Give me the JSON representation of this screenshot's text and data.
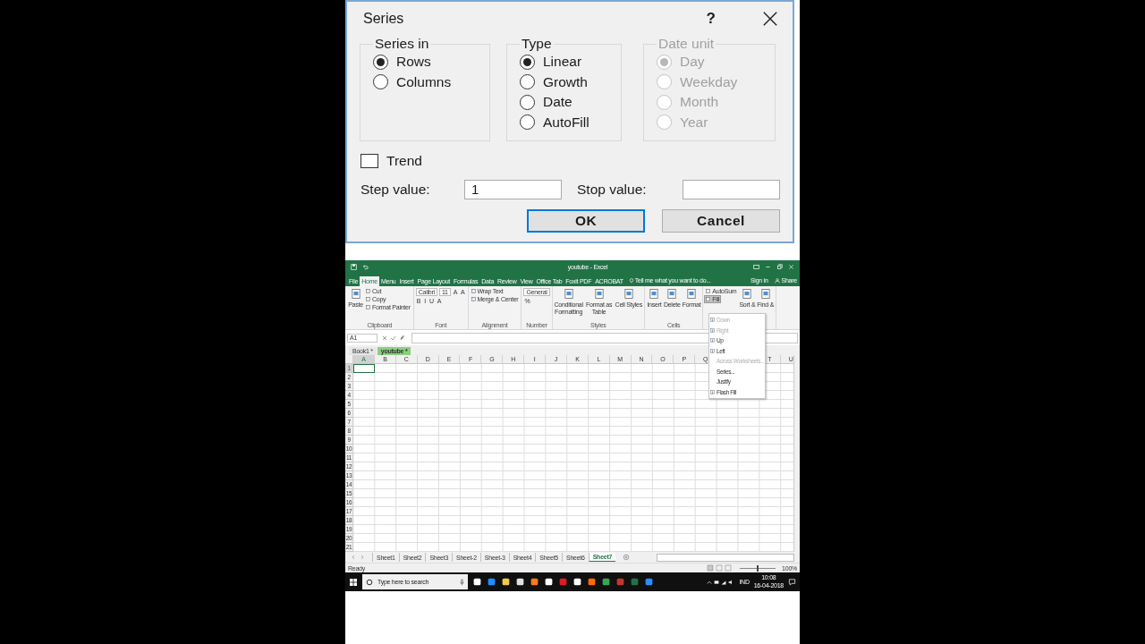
{
  "dialog": {
    "title": "Series",
    "help": "?",
    "groups": [
      {
        "title": "Series in",
        "disabled": false,
        "options": [
          {
            "label": "Rows",
            "selected": true,
            "disabled": false
          },
          {
            "label": "Columns",
            "selected": false,
            "disabled": false
          }
        ]
      },
      {
        "title": "Type",
        "disabled": false,
        "options": [
          {
            "label": "Linear",
            "selected": true,
            "disabled": false
          },
          {
            "label": "Growth",
            "selected": false,
            "disabled": false
          },
          {
            "label": "Date",
            "selected": false,
            "disabled": false
          },
          {
            "label": "AutoFill",
            "selected": false,
            "disabled": false
          }
        ]
      },
      {
        "title": "Date unit",
        "disabled": true,
        "options": [
          {
            "label": "Day",
            "selected": true,
            "disabled": true
          },
          {
            "label": "Weekday",
            "selected": false,
            "disabled": true
          },
          {
            "label": "Month",
            "selected": false,
            "disabled": true
          },
          {
            "label": "Year",
            "selected": false,
            "disabled": true
          }
        ]
      }
    ],
    "trend": {
      "label": "Trend",
      "checked": false
    },
    "fields": [
      {
        "label": "Step value:",
        "value": "1"
      },
      {
        "label": "Stop value:"
      }
    ],
    "buttons": [
      {
        "label": "OK",
        "default": true
      },
      {
        "label": "Cancel",
        "default": false
      }
    ]
  },
  "excel": {
    "title": "youtube - Excel",
    "tabs": [
      {
        "label": "File",
        "selected": false
      },
      {
        "label": "Home",
        "selected": true
      },
      {
        "label": "Menu",
        "selected": false
      },
      {
        "label": "Insert",
        "selected": false
      },
      {
        "label": "Page Layout",
        "selected": false
      },
      {
        "label": "Formulas",
        "selected": false
      },
      {
        "label": "Data",
        "selected": false
      },
      {
        "label": "Review",
        "selected": false
      },
      {
        "label": "View",
        "selected": false
      },
      {
        "label": "Office Tab",
        "selected": false
      },
      {
        "label": "Foxit PDF",
        "selected": false
      },
      {
        "label": "ACROBAT",
        "selected": false
      }
    ],
    "tell_me": "Tell me what you want to do...",
    "sign_in": "Sign in",
    "share": "Share",
    "ribbon": [
      {
        "label": "Clipboard",
        "cols": [
          [
            [
              {
                "kind": "large",
                "label": "Paste"
              }
            ]
          ],
          [
            [
              {
                "kind": "small",
                "label": "Cut",
                "pressed": false
              }
            ],
            [
              {
                "kind": "small",
                "label": "Copy",
                "pressed": false
              }
            ],
            [
              {
                "kind": "small",
                "label": "Format Painter",
                "pressed": false
              }
            ]
          ]
        ]
      },
      {
        "label": "Font",
        "cols": [
          [
            [
              {
                "kind": "field",
                "label": "Calibri"
              },
              {
                "kind": "field",
                "label": "11"
              },
              {
                "kind": "glyph",
                "label": "A"
              },
              {
                "kind": "glyph",
                "label": "A"
              }
            ],
            [
              {
                "kind": "glyph",
                "label": "B"
              },
              {
                "kind": "glyph",
                "label": "I"
              },
              {
                "kind": "glyph",
                "label": "U"
              },
              {
                "kind": "glyph",
                "label": "A"
              }
            ]
          ]
        ]
      },
      {
        "label": "Alignment",
        "cols": [
          [
            [
              {
                "kind": "small",
                "label": "Wrap Text",
                "pressed": false
              }
            ],
            [
              {
                "kind": "small",
                "label": "Merge & Center",
                "pressed": false
              }
            ]
          ]
        ]
      },
      {
        "label": "Number",
        "cols": [
          [
            [
              {
                "kind": "field",
                "label": "General"
              }
            ],
            [
              {
                "kind": "glyph",
                "label": "%"
              }
            ]
          ]
        ]
      },
      {
        "label": "Styles",
        "cols": [
          [
            [
              {
                "kind": "large",
                "label": "Conditional Formatting"
              }
            ]
          ],
          [
            [
              {
                "kind": "large",
                "label": "Format as Table"
              }
            ]
          ],
          [
            [
              {
                "kind": "large",
                "label": "Cell Styles"
              }
            ]
          ]
        ]
      },
      {
        "label": "Cells",
        "cols": [
          [
            [
              {
                "kind": "large",
                "label": "Insert"
              }
            ]
          ],
          [
            [
              {
                "kind": "large",
                "label": "Delete"
              }
            ]
          ],
          [
            [
              {
                "kind": "large",
                "label": "Format"
              }
            ]
          ]
        ]
      },
      {
        "cols": [
          [
            [
              {
                "kind": "small",
                "label": "AutoSum",
                "pressed": false
              }
            ],
            [
              {
                "kind": "small",
                "label": "Fill",
                "pressed": true
              }
            ]
          ],
          [
            [
              {
                "kind": "large",
                "label": "Sort &"
              }
            ]
          ],
          [
            [
              {
                "kind": "large",
                "label": "Find &"
              }
            ]
          ]
        ]
      }
    ],
    "fill_menu": [
      {
        "label": "Down",
        "kind": "icon",
        "disabled": true
      },
      {
        "label": "Right",
        "kind": "icon",
        "disabled": true
      },
      {
        "label": "Up",
        "kind": "icon",
        "disabled": false
      },
      {
        "label": "Left",
        "kind": "icon",
        "disabled": false
      },
      {
        "label": "Across Worksheets...",
        "kind": "text",
        "disabled": true
      },
      {
        "label": "Series...",
        "kind": "text",
        "disabled": false
      },
      {
        "label": "Justify",
        "kind": "text",
        "disabled": false
      },
      {
        "label": "Flash Fill",
        "kind": "icon",
        "disabled": false
      }
    ],
    "name_box": "A1",
    "workbook_tabs": [
      {
        "label": "Book1 *",
        "selected": false
      },
      {
        "label": "youtube *",
        "selected": true
      }
    ],
    "columns": [
      {
        "label": "A",
        "selected": true
      },
      {
        "label": "B",
        "selected": false
      },
      {
        "label": "C",
        "selected": false
      },
      {
        "label": "D",
        "selected": false
      },
      {
        "label": "E",
        "selected": false
      },
      {
        "label": "F",
        "selected": false
      },
      {
        "label": "G",
        "selected": false
      },
      {
        "label": "H",
        "selected": false
      },
      {
        "label": "I",
        "selected": false
      },
      {
        "label": "J",
        "selected": false
      },
      {
        "label": "K",
        "selected": false
      },
      {
        "label": "L",
        "selected": false
      },
      {
        "label": "M",
        "selected": false
      },
      {
        "label": "N",
        "selected": false
      },
      {
        "label": "O",
        "selected": false
      },
      {
        "label": "P",
        "selected": false
      },
      {
        "label": "Q",
        "selected": false
      },
      {},
      {},
      {
        "label": "T",
        "selected": false
      },
      {
        "label": "U",
        "selected": false
      }
    ],
    "rows": [
      {
        "label": "1",
        "selected": true
      },
      {
        "label": "2",
        "selected": false
      },
      {
        "label": "3",
        "selected": false
      },
      {
        "label": "4",
        "selected": false
      },
      {
        "label": "5",
        "selected": false
      },
      {
        "label": "6",
        "selected": false
      },
      {
        "label": "7",
        "selected": false
      },
      {
        "label": "8",
        "selected": false
      },
      {
        "label": "9",
        "selected": false
      },
      {
        "label": "10",
        "selected": false
      },
      {
        "label": "11",
        "selected": false
      },
      {
        "label": "12",
        "selected": false
      },
      {
        "label": "13",
        "selected": false
      },
      {
        "label": "14",
        "selected": false
      },
      {
        "label": "15",
        "selected": false
      },
      {
        "label": "16",
        "selected": false
      },
      {
        "label": "17",
        "selected": false
      },
      {
        "label": "18",
        "selected": false
      },
      {
        "label": "19",
        "selected": false
      },
      {
        "label": "20",
        "selected": false
      },
      {
        "label": "21",
        "selected": false
      }
    ],
    "sheets": [
      {
        "label": "Sheet1",
        "selected": false
      },
      {
        "label": "Sheet2",
        "selected": false
      },
      {
        "label": "Sheet3",
        "selected": false
      },
      {
        "label": "Sheet-2",
        "selected": false
      },
      {
        "label": "Sheet-3",
        "selected": false
      },
      {
        "label": "Sheet4",
        "selected": false
      },
      {
        "label": "Sheet5",
        "selected": false
      },
      {
        "label": "Sheet6",
        "selected": false
      },
      {
        "label": "Sheet7",
        "selected": true
      }
    ],
    "status": "Ready",
    "zoom_slider": {
      "level": 0.5
    },
    "zoom": "100%"
  },
  "taskbar": {
    "search": "Type here to search",
    "lang": "IND",
    "time": "10:08",
    "date": "16-04-2018"
  }
}
